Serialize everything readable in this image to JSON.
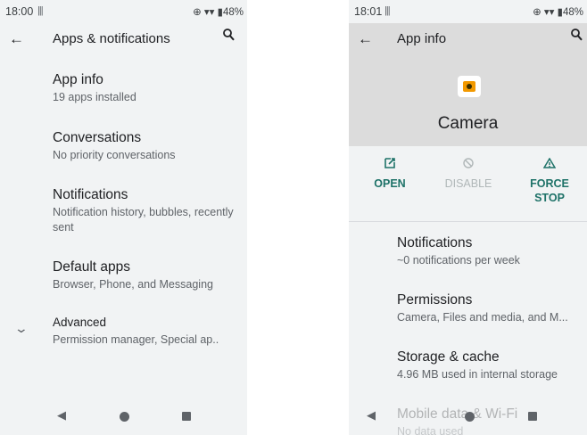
{
  "left_screen": {
    "status": {
      "time": "18:00",
      "notif_icon": "|||",
      "icons": "⊕ ▾▾ ▮48%"
    },
    "toolbar": {
      "title": "Apps & notifications"
    },
    "items": [
      {
        "title": "App info",
        "subtitle": "19 apps installed"
      },
      {
        "title": "Conversations",
        "subtitle": "No priority conversations"
      },
      {
        "title": "Notifications",
        "subtitle": "Notification history, bubbles, recently sent"
      },
      {
        "title": "Default apps",
        "subtitle": "Browser, Phone, and Messaging"
      },
      {
        "title": "Advanced",
        "subtitle": "Permission manager, Special ap.."
      }
    ]
  },
  "right_screen": {
    "status": {
      "time": "18:01",
      "notif_icon": "|||",
      "icons": "⊕ ▾▾ ▮48%"
    },
    "toolbar": {
      "title": "App info"
    },
    "app": {
      "name": "Camera"
    },
    "actions": [
      {
        "label": "OPEN",
        "icon": "open-in-new-icon",
        "enabled": true
      },
      {
        "label": "DISABLE",
        "icon": "disable-icon",
        "enabled": false
      },
      {
        "label": "FORCE STOP",
        "icon": "warning-icon",
        "enabled": true
      }
    ],
    "items": [
      {
        "title": "Notifications",
        "subtitle": "~0 notifications per week"
      },
      {
        "title": "Permissions",
        "subtitle": "Camera, Files and media, and M..."
      },
      {
        "title": "Storage & cache",
        "subtitle": "4.96 MB used in internal storage"
      },
      {
        "title": "Mobile data & Wi-Fi",
        "subtitle": "No data used"
      }
    ]
  },
  "colors": {
    "accent": "#1e7268",
    "background": "#f1f3f4",
    "header": "#dcdcdc"
  }
}
